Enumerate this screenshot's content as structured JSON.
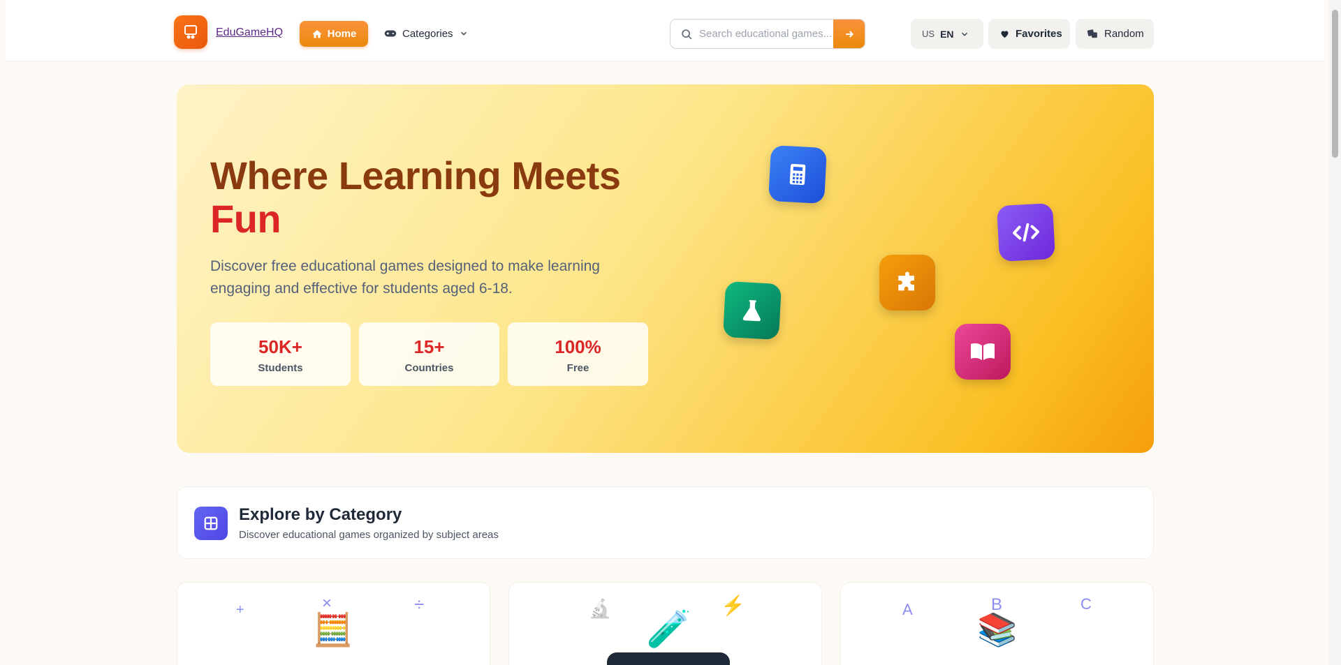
{
  "header": {
    "logo_text": "EduGameHQ",
    "home_label": "Home",
    "categories_label": "Categories",
    "search_placeholder": "Search educational games...",
    "lang_code": "US",
    "lang_label": "EN",
    "favorites_label": "Favorites",
    "random_label": "Random"
  },
  "hero": {
    "title_line1": "Where Learning Meets",
    "title_line2": "Fun",
    "subtitle": "Discover free educational games designed to make learning engaging and effective for students aged 6-18.",
    "stats": [
      {
        "value": "50K+",
        "label": "Students"
      },
      {
        "value": "15+",
        "label": "Countries"
      },
      {
        "value": "100%",
        "label": "Free"
      }
    ],
    "tiles": [
      {
        "icon": "calculator-icon",
        "color": "#2563eb"
      },
      {
        "icon": "code-icon",
        "color": "#7c3aed"
      },
      {
        "icon": "puzzle-icon",
        "color": "#ea8a0c"
      },
      {
        "icon": "flask-icon",
        "color": "#059669"
      },
      {
        "icon": "book-icon",
        "color": "#db2777"
      }
    ]
  },
  "explore": {
    "title": "Explore by Category",
    "subtitle": "Discover educational games organized by subject areas"
  },
  "cards": [
    {
      "symbols": [
        "+",
        "×",
        "÷"
      ],
      "emoji": "🧮"
    },
    {
      "symbols": [
        "🔬",
        "⚡"
      ],
      "emoji": "🧪"
    },
    {
      "symbols": [
        "A",
        "B",
        "C"
      ],
      "emoji": "📚"
    }
  ],
  "colors": {
    "accent": "#ea8a0c",
    "title": "#8a3a0f",
    "highlight": "#dc2626",
    "indigo": "#4f46e5"
  }
}
